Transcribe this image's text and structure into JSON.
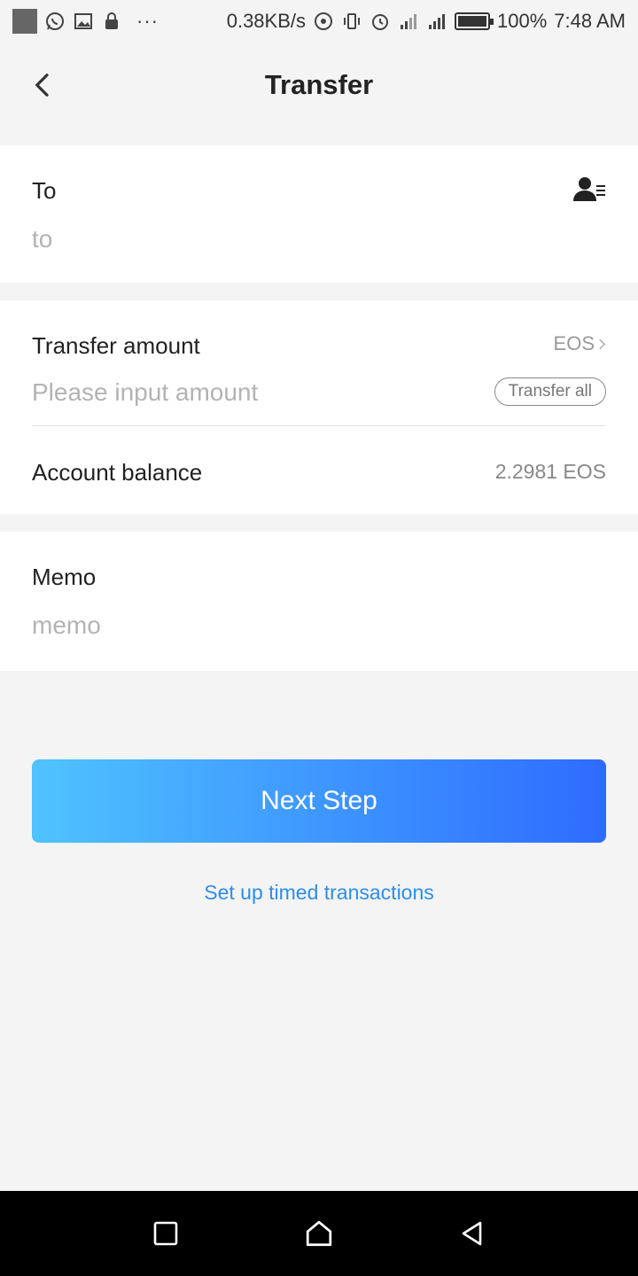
{
  "status_bar": {
    "net_speed": "0.38KB/s",
    "battery": "100%",
    "time": "7:48 AM",
    "more": "···"
  },
  "header": {
    "title": "Transfer"
  },
  "to_section": {
    "label": "To",
    "placeholder": "to"
  },
  "amount_section": {
    "label": "Transfer amount",
    "token": "EOS",
    "placeholder": "Please input amount",
    "transfer_all_label": "Transfer all",
    "balance_label": "Account balance",
    "balance_value": "2.2981 EOS"
  },
  "memo_section": {
    "label": "Memo",
    "placeholder": "memo"
  },
  "actions": {
    "next_label": "Next Step",
    "timed_link": "Set up timed transactions"
  },
  "colors": {
    "gradient_start": "#4fc3ff",
    "gradient_end": "#2e6bff",
    "link": "#2d8ee8",
    "background": "#f4f4f4"
  }
}
